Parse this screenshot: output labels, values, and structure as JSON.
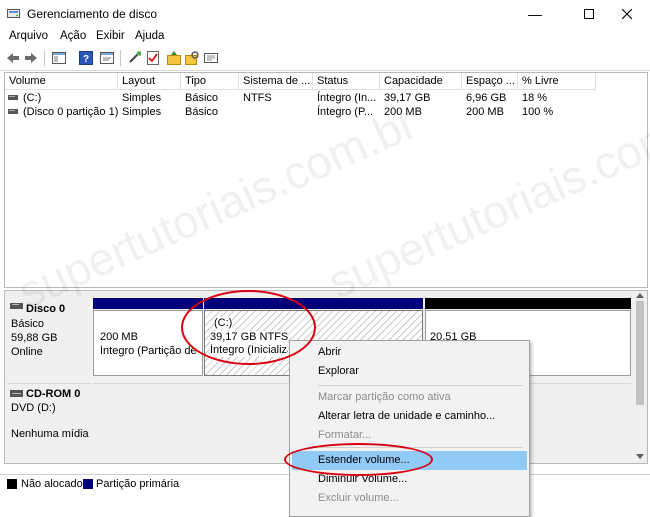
{
  "window": {
    "title": "Gerenciamento de disco"
  },
  "menu": {
    "items": [
      "Arquivo",
      "Ação",
      "Exibir",
      "Ajuda"
    ]
  },
  "list": {
    "columns": [
      "Volume",
      "Layout",
      "Tipo",
      "Sistema de ...",
      "Status",
      "Capacidade",
      "Espaço ...",
      "% Livre"
    ],
    "rows": [
      [
        "(C:)",
        "Simples",
        "Básico",
        "NTFS",
        "Íntegro (In...",
        "39,17 GB",
        "6,96 GB",
        "18 %"
      ],
      [
        "(Disco 0 partição 1)",
        "Simples",
        "Básico",
        "",
        "Íntegro (P...",
        "200 MB",
        "200 MB",
        "100 %"
      ]
    ]
  },
  "disks": [
    {
      "name": "Disco 0",
      "type": "Básico",
      "size": "59,88 GB",
      "status": "Online",
      "partitions": [
        {
          "size": "200 MB",
          "status": "Íntegro (Partição de S"
        },
        {
          "label": "(C:)",
          "size": "39,17 GB NTFS",
          "status": "Íntegro (Inicializa"
        },
        {
          "size": "20,51 GB"
        }
      ]
    },
    {
      "name": "CD-ROM 0",
      "type": "DVD (D:)",
      "status": "Nenhuma mídia"
    }
  ],
  "legend": [
    {
      "label": "Não alocado",
      "color": "#000000"
    },
    {
      "label": "Partição primária",
      "color": "#00007b"
    }
  ],
  "context_menu": {
    "items": [
      {
        "label": "Abrir",
        "enabled": true
      },
      {
        "label": "Explorar",
        "enabled": true
      },
      {
        "label": "Marcar partição como ativa",
        "enabled": false
      },
      {
        "label": "Alterar letra de unidade e caminho...",
        "enabled": true
      },
      {
        "label": "Formatar...",
        "enabled": false
      },
      {
        "label": "Estender volume...",
        "enabled": true,
        "highlighted": true
      },
      {
        "label": "Diminuir Volume...",
        "enabled": true
      },
      {
        "label": "Excluir volume...",
        "enabled": false
      }
    ]
  },
  "watermark": "supertutoriais.com.br",
  "colors": {
    "primary_partition": "#00007b",
    "unallocated": "#000000",
    "highlight": "#91c9f7",
    "annotation": "#d9000f"
  }
}
